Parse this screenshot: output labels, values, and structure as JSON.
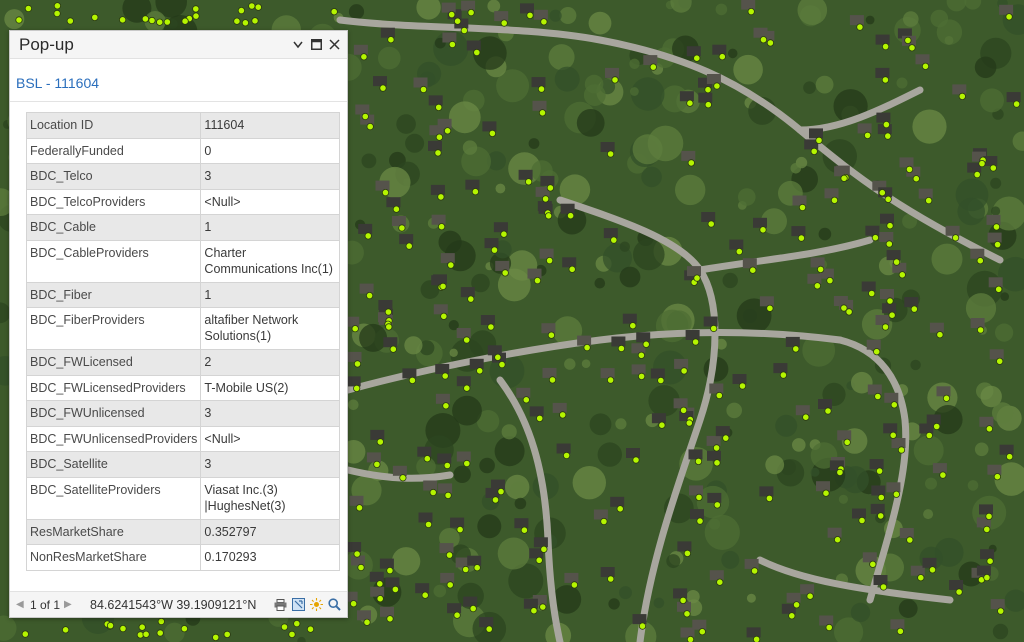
{
  "map": {
    "background_color": "#3f5a2c",
    "road_color": "#a6a49c",
    "point_color": "#b5f500",
    "point_outline": "#2a3a10"
  },
  "popup": {
    "title": "Pop-up",
    "header_icons": [
      "dropdown-icon",
      "maximize-icon",
      "close-icon"
    ],
    "feature_title": "BSL - 111604",
    "rows": [
      {
        "field": "Location ID",
        "value": "111604"
      },
      {
        "field": "FederallyFunded",
        "value": "0"
      },
      {
        "field": "BDC_Telco",
        "value": "3"
      },
      {
        "field": "BDC_TelcoProviders",
        "value": "<Null>"
      },
      {
        "field": "BDC_Cable",
        "value": "1"
      },
      {
        "field": "BDC_CableProviders",
        "value": "Charter Communications Inc(1)"
      },
      {
        "field": "BDC_Fiber",
        "value": "1"
      },
      {
        "field": "BDC_FiberProviders",
        "value": "altafiber Network Solutions(1)"
      },
      {
        "field": "BDC_FWLicensed",
        "value": "2"
      },
      {
        "field": "BDC_FWLicensedProviders",
        "value": "T-Mobile US(2)"
      },
      {
        "field": "BDC_FWUnlicensed",
        "value": "3"
      },
      {
        "field": "BDC_FWUnlicensedProviders",
        "value": "<Null>"
      },
      {
        "field": "BDC_Satellite",
        "value": "3"
      },
      {
        "field": "BDC_SatelliteProviders",
        "value": "Viasat Inc.(3) |HughesNet(3)"
      },
      {
        "field": "ResMarketShare",
        "value": "0.352797"
      },
      {
        "field": "NonResMarketShare",
        "value": "0.170293"
      }
    ],
    "footer": {
      "page_indicator": "1 of 1",
      "coordinates": "84.6241543°W 39.1909121°N",
      "tool_icons": [
        "print-icon",
        "zoom-to-icon",
        "flash-icon",
        "search-icon"
      ]
    }
  }
}
